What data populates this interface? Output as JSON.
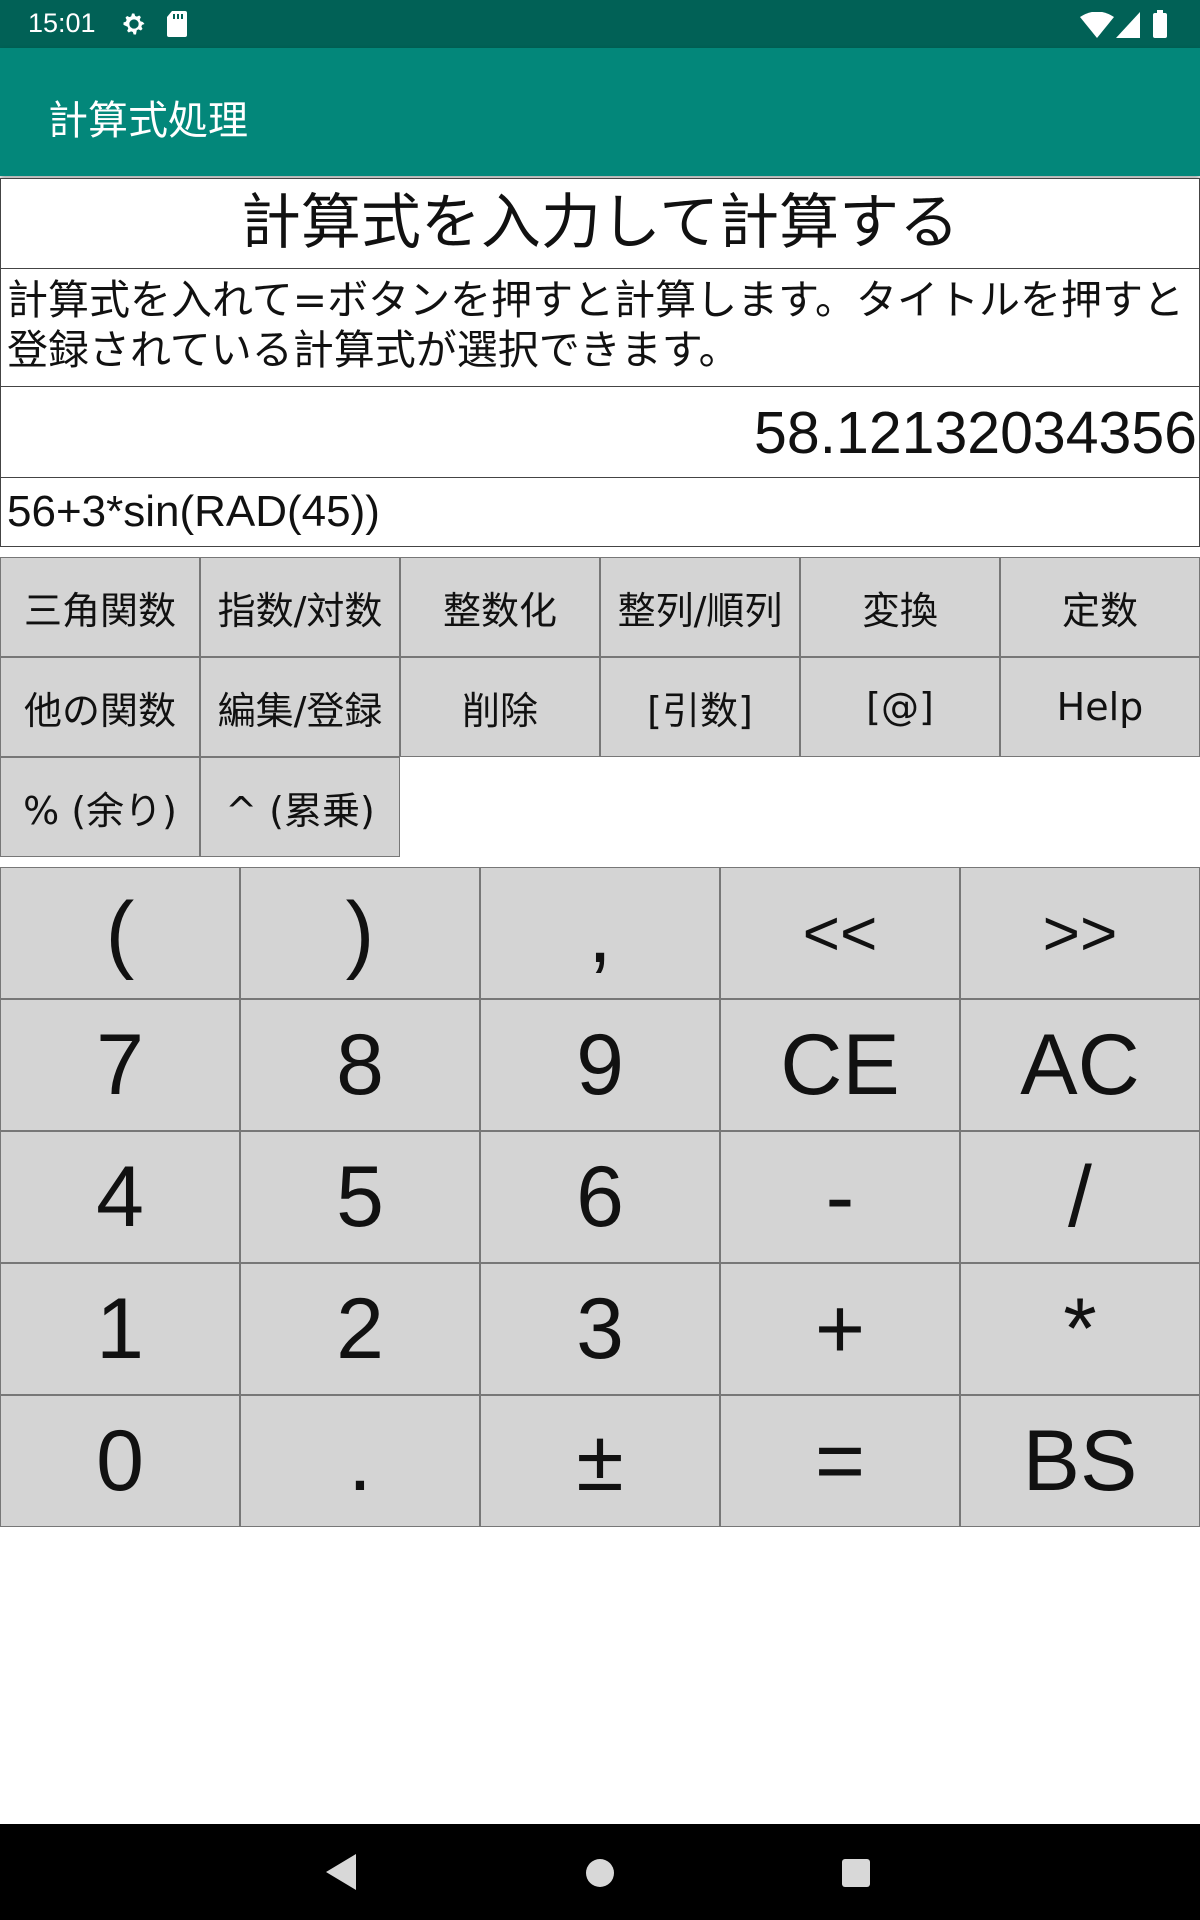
{
  "status_bar": {
    "time": "15:01",
    "icons": [
      "gear-icon",
      "sd-card-icon",
      "wifi-icon",
      "signal-icon",
      "battery-icon"
    ]
  },
  "app_bar": {
    "title": "計算式処理"
  },
  "heading": "計算式を入力して計算する",
  "description": "計算式を入れて=ボタンを押すと計算します。タイトルを押すと登録されている計算式が選択できます。",
  "result": "58.12132034356",
  "formula": "56+3*sin(RAD(45))",
  "function_buttons": [
    "三角関数",
    "指数/対数",
    "整数化",
    "整列/順列",
    "変換",
    "定数",
    "他の関数",
    "編集/登録",
    "削除",
    "[引数]",
    "[@]",
    "Help",
    "% (余り)",
    "^ (累乗)"
  ],
  "keypad": [
    "(",
    ")",
    ",",
    "<<",
    ">>",
    "7",
    "8",
    "9",
    "CE",
    "AC",
    "4",
    "5",
    "6",
    "-",
    "/",
    "1",
    "2",
    "3",
    "+",
    "*",
    "0",
    ".",
    "±",
    "=",
    "BS"
  ],
  "colors": {
    "status_bar": "#016156",
    "app_bar": "#03877a",
    "button_bg": "#d4d4d4"
  }
}
